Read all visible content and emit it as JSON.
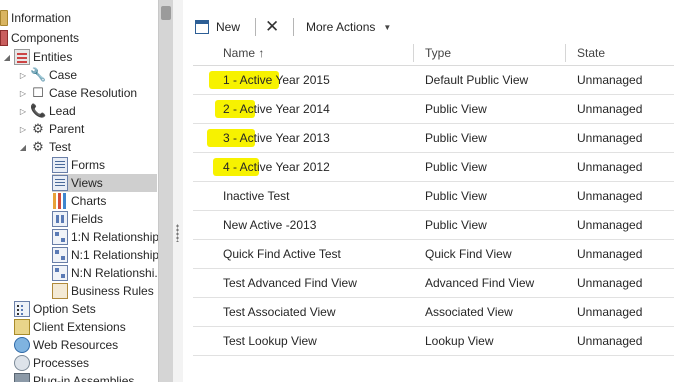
{
  "nav": {
    "items": [
      {
        "label": "Information"
      },
      {
        "label": "Components"
      },
      {
        "label": "Entities"
      },
      {
        "label": "Case"
      },
      {
        "label": "Case Resolution"
      },
      {
        "label": "Lead"
      },
      {
        "label": "Parent"
      },
      {
        "label": "Test"
      },
      {
        "label": "Forms"
      },
      {
        "label": "Views"
      },
      {
        "label": "Charts"
      },
      {
        "label": "Fields"
      },
      {
        "label": "1:N Relationships"
      },
      {
        "label": "N:1 Relationships"
      },
      {
        "label": "N:N Relationshi..."
      },
      {
        "label": "Business Rules"
      },
      {
        "label": "Option Sets"
      },
      {
        "label": "Client Extensions"
      },
      {
        "label": "Web Resources"
      },
      {
        "label": "Processes"
      },
      {
        "label": "Plug-in Assemblies"
      }
    ],
    "glyphs": {
      "expanded": "◢",
      "collapsed": "▷",
      "wrench": "🔧",
      "case_resolution": "☐",
      "phone": "📞",
      "gear": "⚙"
    }
  },
  "toolbar": {
    "new_label": "New",
    "delete_glyph": "✕",
    "more_actions_label": "More Actions",
    "caret": "▼"
  },
  "grid": {
    "columns": {
      "name": "Name ↑",
      "type": "Type",
      "state": "State"
    },
    "rows": [
      {
        "name": "1 - Active Year 2015",
        "type": "Default Public View",
        "state": "Unmanaged"
      },
      {
        "name": "2 - Active Year 2014",
        "type": "Public View",
        "state": "Unmanaged"
      },
      {
        "name": "3 - Active Year 2013",
        "type": "Public View",
        "state": "Unmanaged"
      },
      {
        "name": "4 - Active Year 2012",
        "type": "Public View",
        "state": "Unmanaged"
      },
      {
        "name": "Inactive Test",
        "type": "Public View",
        "state": "Unmanaged"
      },
      {
        "name": "New Active -2013",
        "type": "Public View",
        "state": "Unmanaged"
      },
      {
        "name": "Quick Find Active Test",
        "type": "Quick Find View",
        "state": "Unmanaged"
      },
      {
        "name": "Test Advanced Find View",
        "type": "Advanced Find View",
        "state": "Unmanaged"
      },
      {
        "name": "Test Associated View",
        "type": "Associated View",
        "state": "Unmanaged"
      },
      {
        "name": "Test Lookup View",
        "type": "Lookup View",
        "state": "Unmanaged"
      }
    ]
  },
  "colors": {
    "highlight": "#f7f200",
    "selected_row": "#cfcfcf",
    "accent": "#2d5f96"
  }
}
